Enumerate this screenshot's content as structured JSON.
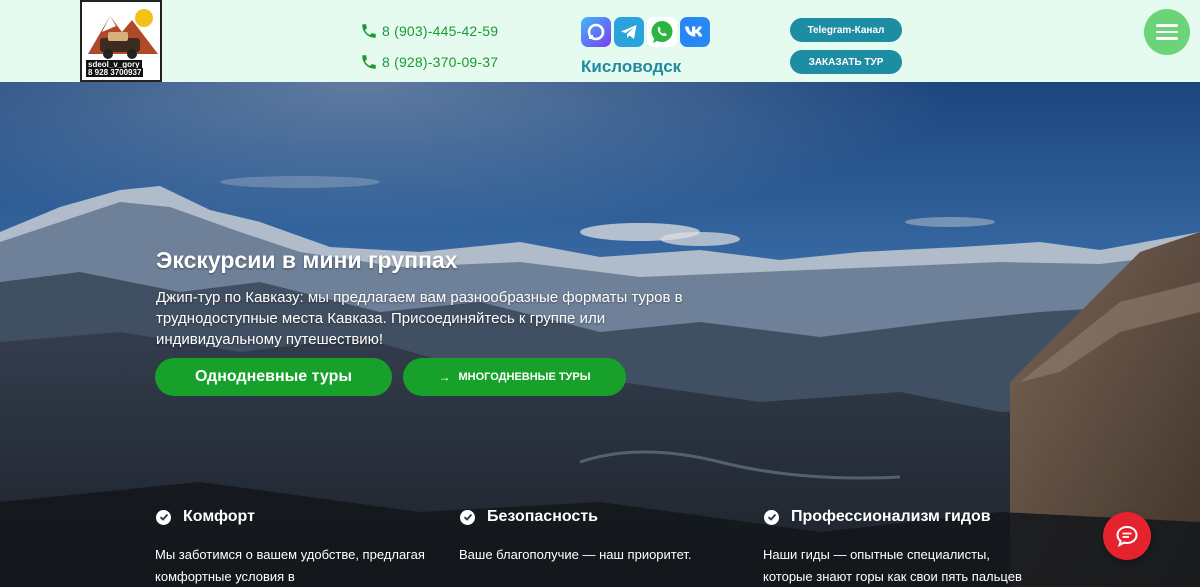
{
  "header": {
    "logo": {
      "line1": "sdeol_v_gory",
      "line2": "8 928 3700937"
    },
    "phones": [
      "8 (903)-445-42-59",
      "8 (928)-370-09-37"
    ],
    "socials": [
      {
        "name": "max",
        "color": "#5b5ef5"
      },
      {
        "name": "telegram",
        "color": "#2aa3dd"
      },
      {
        "name": "whatsapp",
        "color": "#2bb540"
      },
      {
        "name": "vk",
        "color": "#2787f5"
      }
    ],
    "city": "Кисловодск",
    "telegram_button": "Telegram-Канал",
    "order_button": "ЗАКАЗАТЬ ТУР"
  },
  "hero": {
    "title": "Экскурсии в мини группах",
    "description": "Джип-тур по Кавказу: мы предлагаем вам разнообразные форматы туров в труднодоступные места Кавказа. Присоединяйтесь к группе или индивидуальному путешествию!",
    "btn_one_day": "Однодневные туры",
    "btn_multi_arrow": "→",
    "btn_multi_day": "МНОГОДНЕВНЫЕ ТУРЫ"
  },
  "features": [
    {
      "title": "Комфорт",
      "text": "Мы заботимся о вашем удобстве, предлагая комфортные условия в"
    },
    {
      "title": "Безопасность",
      "text": "Ваше благополучие — наш приоритет."
    },
    {
      "title": "Профессионализм гидов",
      "text": "Наши гиды — опытные специалисты, которые знают горы как свои пять пальцев"
    }
  ],
  "colors": {
    "accent_green": "#17a12b",
    "teal": "#1d8da4",
    "chat_red": "#e5232f"
  }
}
